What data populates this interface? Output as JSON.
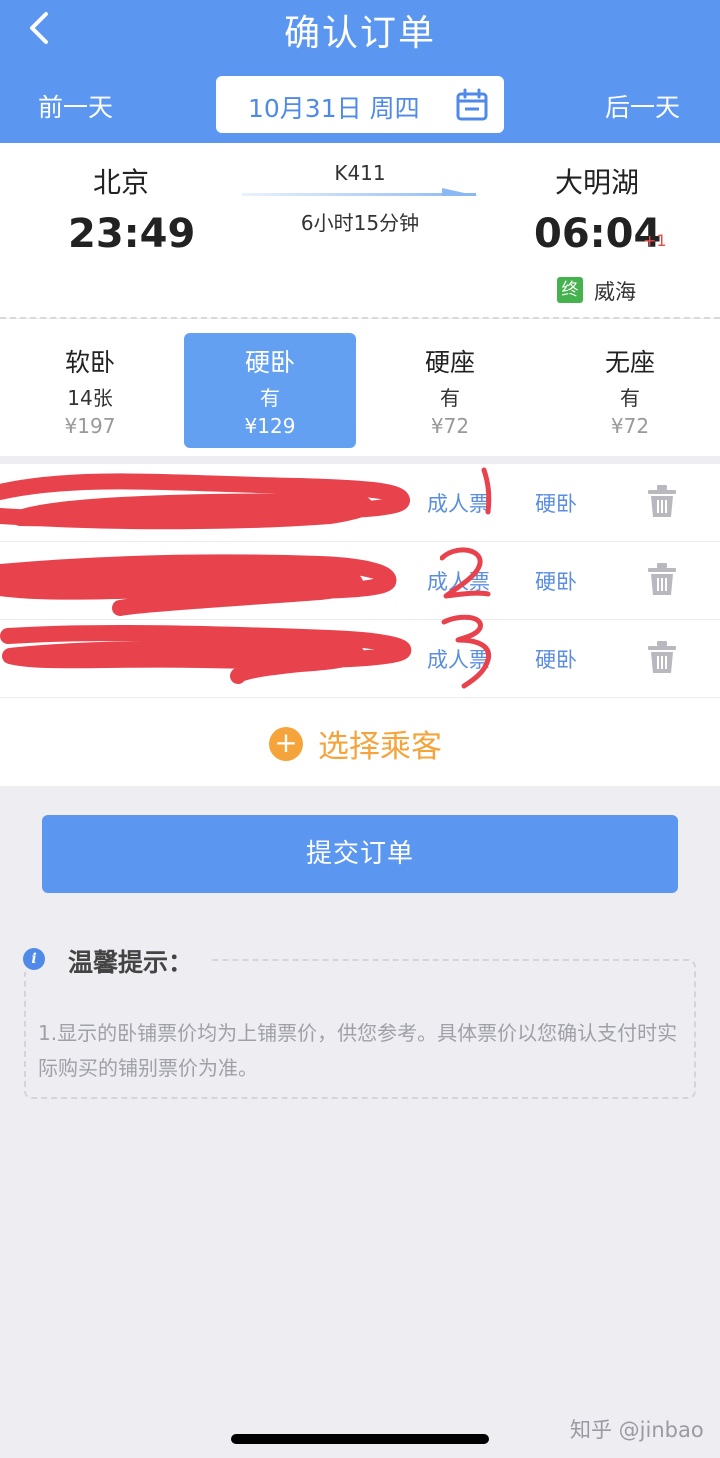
{
  "header": {
    "title": "确认订单",
    "prev_day": "前一天",
    "next_day": "后一天",
    "date": "10月31日 周四",
    "back_icon": "chevron-left-icon",
    "calendar_icon": "calendar-icon",
    "background": "#5b97f0"
  },
  "train": {
    "from_city": "北京",
    "from_time": "23:49",
    "train_no": "K411",
    "duration": "6小时15分钟",
    "to_city": "大明湖",
    "to_time": "06:04",
    "day_offset": "+1",
    "terminal_badge": "终",
    "terminal_city": "威海"
  },
  "seats": [
    {
      "name": "软卧",
      "count": "14张",
      "price": "¥197",
      "selected": false
    },
    {
      "name": "硬卧",
      "count": "有",
      "price": "¥129",
      "selected": true
    },
    {
      "name": "硬座",
      "count": "有",
      "price": "¥72",
      "selected": false
    },
    {
      "name": "无座",
      "count": "有",
      "price": "¥72",
      "selected": false
    }
  ],
  "passengers": [
    {
      "ticket_type": "成人票",
      "seat_type": "硬卧",
      "annotation": "1"
    },
    {
      "ticket_type": "成人票",
      "seat_type": "硬卧",
      "annotation": "2"
    },
    {
      "ticket_type": "成人票",
      "seat_type": "硬卧",
      "annotation": "3"
    }
  ],
  "add_passenger": {
    "label": "选择乘客",
    "icon": "plus-circle-icon",
    "color": "#f5a43c"
  },
  "submit_label": "提交订单",
  "tips": {
    "icon": "info-icon",
    "title": "温馨提示：",
    "text": "1.显示的卧铺票价均为上铺票价，供您参考。具体票价以您确认支付时实际购买的铺别票价为准。"
  },
  "watermark": "知乎 @jinbao",
  "colors": {
    "accent": "#5b97f0",
    "redaction": "#e8434d",
    "orange": "#f5a43c",
    "terminal_green": "#45b24e",
    "day_offset_red": "#e84a4a"
  }
}
